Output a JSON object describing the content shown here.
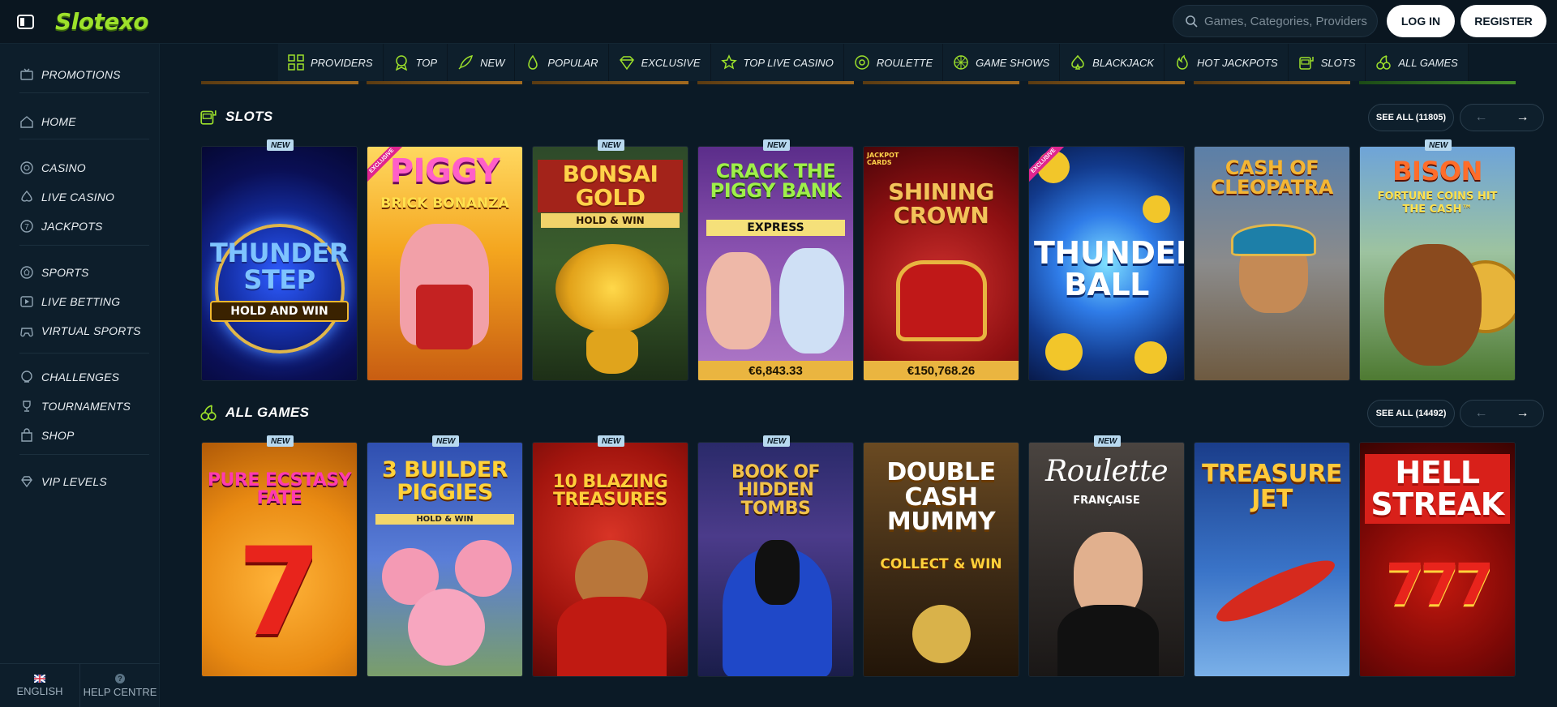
{
  "header": {
    "logo": "Slotexo",
    "search_placeholder": "Games, Categories, Providers",
    "login_label": "LOG IN",
    "register_label": "REGISTER"
  },
  "sidebar": {
    "items": [
      {
        "label": "PROMOTIONS",
        "icon": "promotions-icon"
      },
      {
        "label": "HOME",
        "icon": "home-icon"
      },
      {
        "label": "CASINO",
        "icon": "casino-icon"
      },
      {
        "label": "LIVE CASINO",
        "icon": "live-casino-icon"
      },
      {
        "label": "JACKPOTS",
        "icon": "jackpots-icon"
      },
      {
        "label": "SPORTS",
        "icon": "sports-icon"
      },
      {
        "label": "LIVE BETTING",
        "icon": "live-betting-icon"
      },
      {
        "label": "VIRTUAL SPORTS",
        "icon": "virtual-sports-icon"
      },
      {
        "label": "CHALLENGES",
        "icon": "challenges-icon"
      },
      {
        "label": "TOURNAMENTS",
        "icon": "tournaments-icon"
      },
      {
        "label": "SHOP",
        "icon": "shop-icon"
      },
      {
        "label": "VIP LEVELS",
        "icon": "vip-icon"
      }
    ],
    "footer": {
      "language": "ENGLISH",
      "help": "HELP CENTRE"
    }
  },
  "categories": [
    "PROVIDERS",
    "TOP",
    "NEW",
    "POPULAR",
    "EXCLUSIVE",
    "TOP LIVE CASINO",
    "ROULETTE",
    "GAME SHOWS",
    "BLACKJACK",
    "HOT JACKPOTS",
    "SLOTS",
    "ALL GAMES"
  ],
  "slots": {
    "title": "SLOTS",
    "see_all": "SEE ALL (11805)",
    "games": [
      {
        "title": "THUNDER STEP",
        "subtitle": "HOLD AND WIN",
        "badge": "NEW",
        "jackpot": ""
      },
      {
        "title": "PIGGY",
        "subtitle": "BRICK BONANZA",
        "badge": "EXCLUSIVE",
        "jackpot": ""
      },
      {
        "title": "BONSAI GOLD",
        "subtitle": "HOLD & WIN",
        "badge": "NEW",
        "jackpot": ""
      },
      {
        "title": "CRACK THE PIGGY BANK",
        "subtitle": "EXPRESS",
        "badge": "NEW",
        "jackpot": "€6,843.33"
      },
      {
        "title": "SHINING CROWN",
        "subtitle": "JACKPOT CARDS",
        "badge": "",
        "jackpot": "€150,768.26"
      },
      {
        "title": "THUNDER BALL",
        "subtitle": "",
        "badge": "EXCLUSIVE",
        "jackpot": ""
      },
      {
        "title": "CASH OF CLEOPATRA",
        "subtitle": "",
        "badge": "",
        "jackpot": ""
      },
      {
        "title": "BISON",
        "subtitle": "FORTUNE COINS HIT THE CASH™",
        "badge": "NEW",
        "jackpot": ""
      }
    ]
  },
  "all_games": {
    "title": "ALL GAMES",
    "see_all": "SEE ALL (14492)",
    "games": [
      {
        "title": "PURE ECSTASY FATE",
        "subtitle": "",
        "badge": "NEW"
      },
      {
        "title": "3 BUILDER PIGGIES",
        "subtitle": "HOLD & WIN",
        "badge": "NEW"
      },
      {
        "title": "10 BLAZING TREASURES",
        "subtitle": "",
        "badge": "NEW"
      },
      {
        "title": "BOOK OF HIDDEN TOMBS",
        "subtitle": "",
        "badge": "NEW"
      },
      {
        "title": "DOUBLE CASH MUMMY",
        "subtitle": "COLLECT & WIN",
        "badge": ""
      },
      {
        "title": "Roulette",
        "subtitle": "FRANÇAISE",
        "badge": "NEW"
      },
      {
        "title": "TREASURE JET",
        "subtitle": "",
        "badge": ""
      },
      {
        "title": "HELL STREAK",
        "subtitle": "",
        "badge": ""
      }
    ]
  },
  "colors": {
    "accent": "#9de12b",
    "bg": "#0b1a26",
    "jackpot": "#eab540"
  }
}
